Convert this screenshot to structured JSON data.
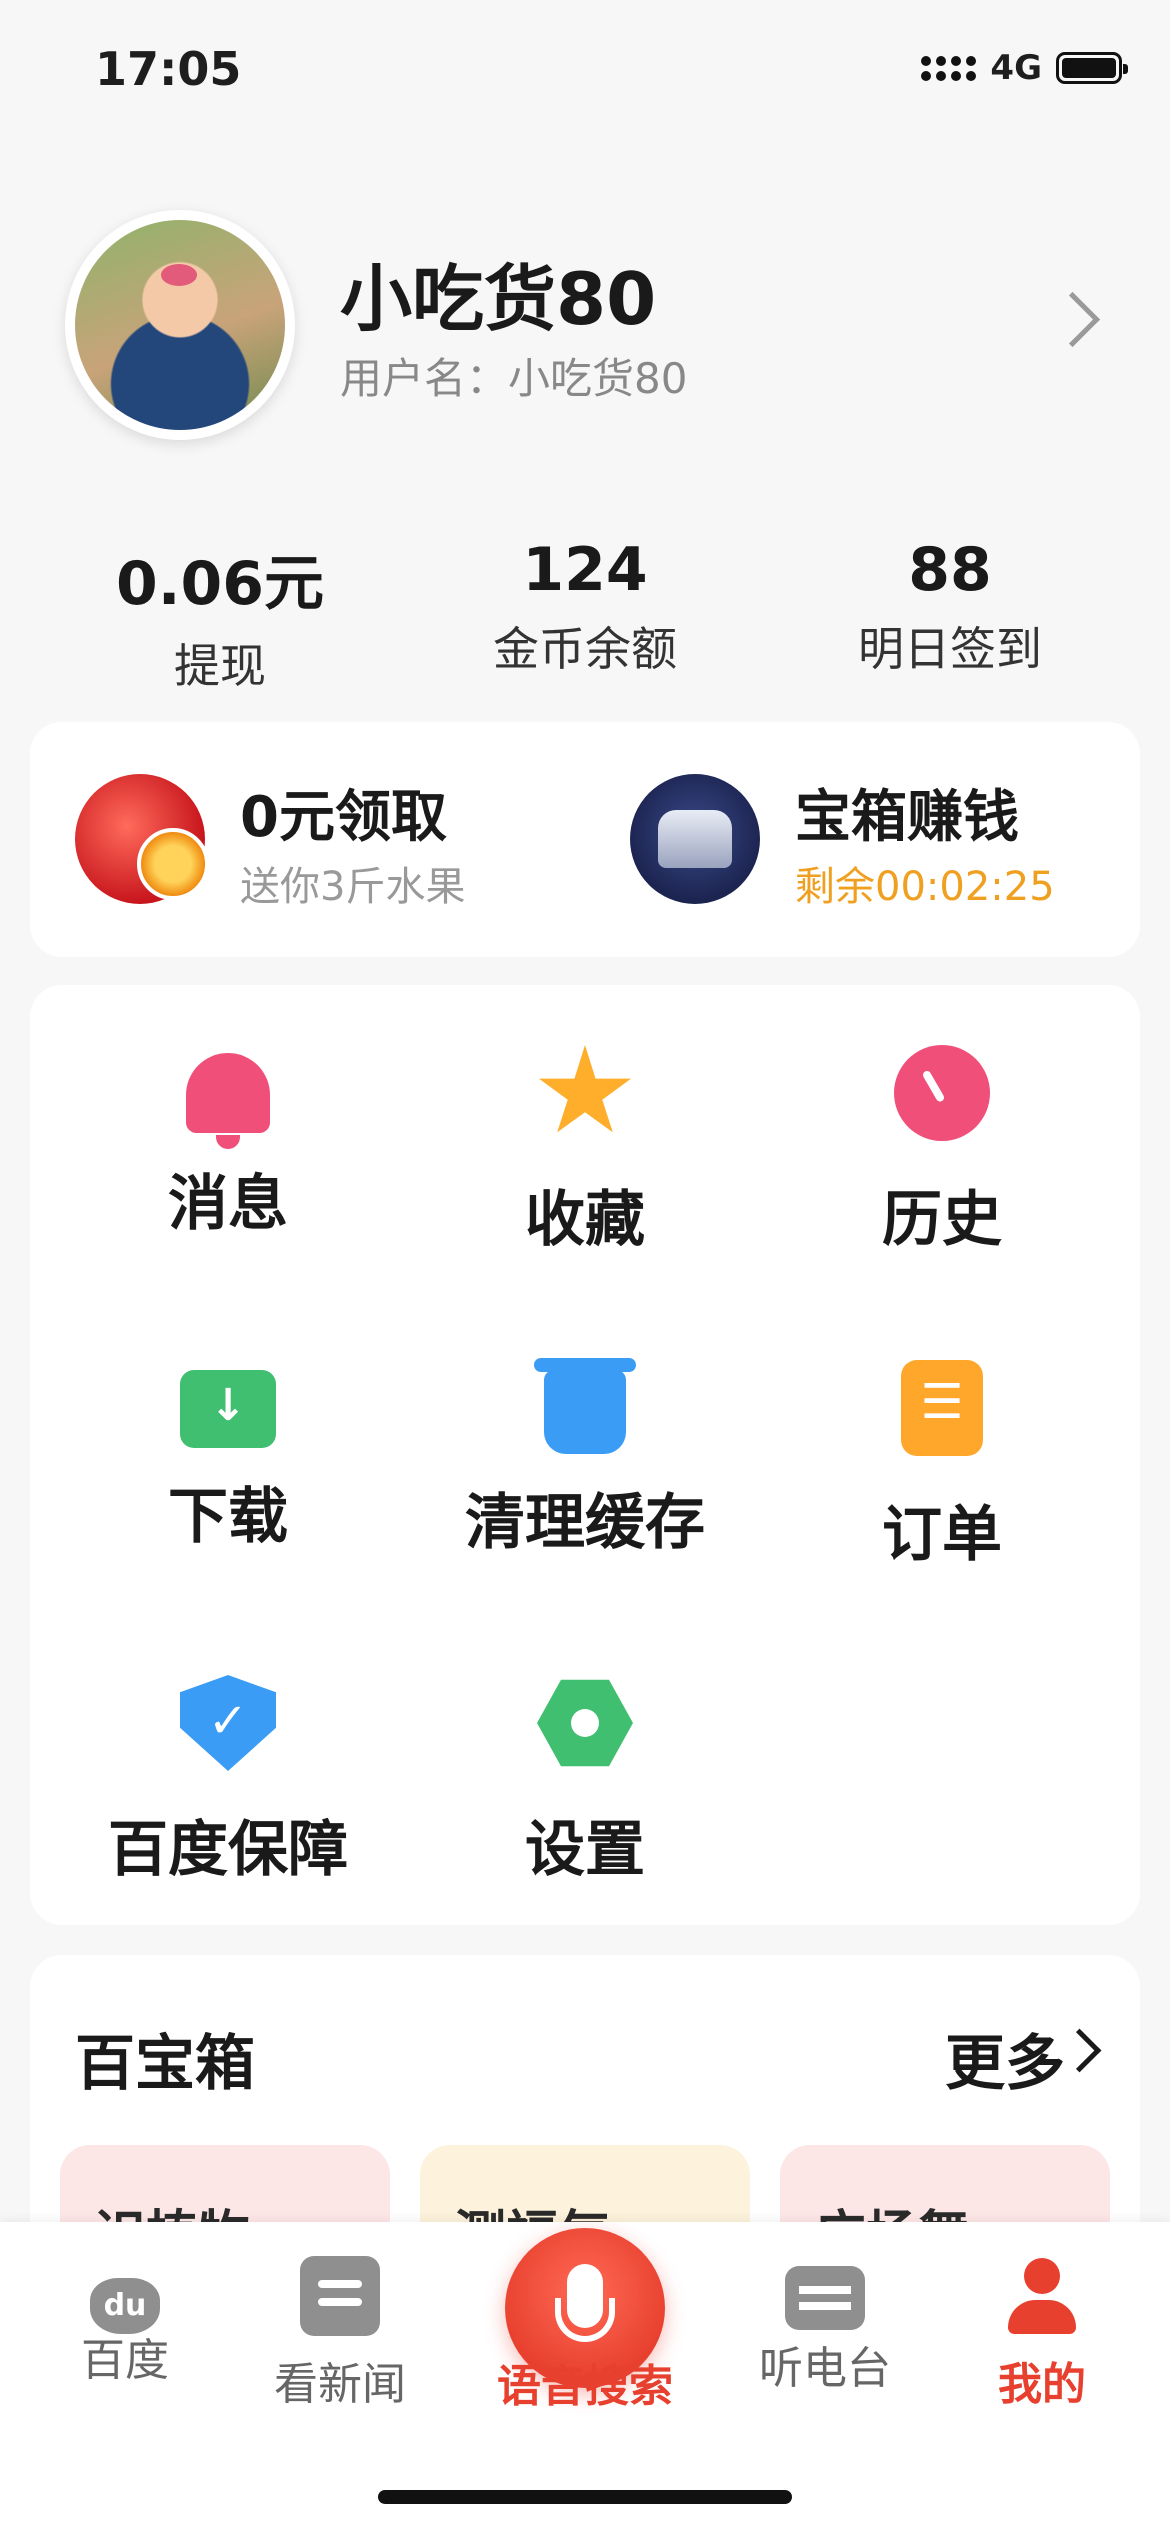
{
  "status_bar": {
    "time": "17:05",
    "network": "4G"
  },
  "profile": {
    "name": "小吃货80",
    "username": "用户名：小吃货80"
  },
  "stats": [
    {
      "value": "0.06元",
      "label": "提现"
    },
    {
      "value": "124",
      "label": "金币余额"
    },
    {
      "value": "88",
      "label": "明日签到"
    }
  ],
  "promo": {
    "left": {
      "title": "0元领取",
      "subtitle": "送你3斤水果",
      "icon": "apple-icon"
    },
    "right": {
      "title": "宝箱赚钱",
      "subtitle": "剩余00:02:25",
      "icon": "treasure-chest-icon"
    }
  },
  "menu": {
    "items": [
      {
        "label": "消息",
        "icon": "bell-icon"
      },
      {
        "label": "收藏",
        "icon": "star-icon"
      },
      {
        "label": "历史",
        "icon": "clock-icon"
      },
      {
        "label": "下载",
        "icon": "download-folder-icon"
      },
      {
        "label": "清理缓存",
        "icon": "trash-icon"
      },
      {
        "label": "订单",
        "icon": "clipboard-icon"
      },
      {
        "label": "百度保障",
        "icon": "shield-icon"
      },
      {
        "label": "设置",
        "icon": "settings-hexagon-icon"
      }
    ]
  },
  "toolbox": {
    "title": "百宝箱",
    "more": "更多",
    "tiles": [
      {
        "label": "识植物",
        "color": "#fde6e6"
      },
      {
        "label": "测福气",
        "color": "#fdf3dc"
      },
      {
        "label": "广场舞",
        "color": "#fde6e6"
      }
    ]
  },
  "bottom_nav": {
    "items": [
      {
        "label": "百度",
        "icon": "baidu-paw-icon"
      },
      {
        "label": "看新闻",
        "icon": "news-icon"
      },
      {
        "label": "语音搜索",
        "icon": "microphone-icon"
      },
      {
        "label": "听电台",
        "icon": "radio-icon"
      },
      {
        "label": "我的",
        "icon": "person-icon"
      }
    ],
    "active": "我的"
  },
  "colors": {
    "accent": "#e8402f",
    "timer": "#f0a020",
    "inactive": "#8f8f8f"
  }
}
